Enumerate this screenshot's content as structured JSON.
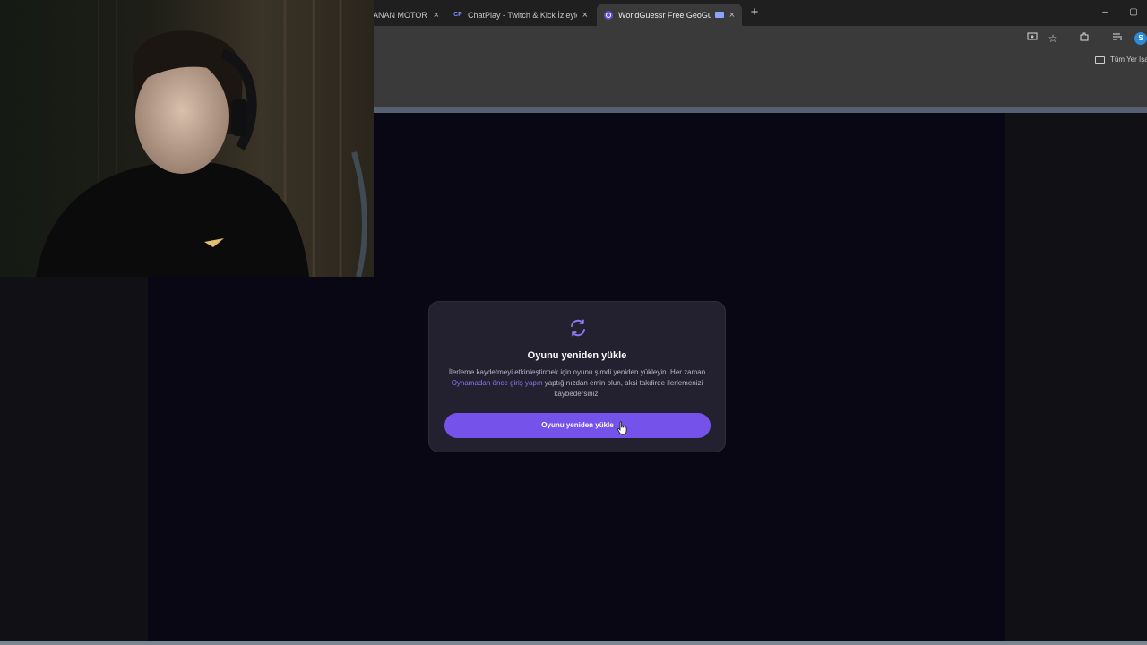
{
  "browser": {
    "tabs": [
      {
        "title": "ANAN MOTOR",
        "favicon": ""
      },
      {
        "title": "ChatPlay - Twitch & Kick İzleyici",
        "favicon": "CP"
      },
      {
        "title": "WorldGuessr Free GeoGuessr",
        "favicon": "worldguessr-logo-icon"
      }
    ],
    "new_tab_label": "+",
    "close_label": "×",
    "minimize_label": "–",
    "maximize_label": "▢",
    "profile_initial": "S",
    "bookmarks_all_label": "Tüm Yer İşa"
  },
  "modal": {
    "icon": "reload-icon",
    "title": "Oyunu yeniden yükle",
    "body_part1": "İlerleme kaydetmeyi etkinleştirmek için oyunu şimdi yeniden yükleyin. Her zaman ",
    "body_link": "Oynamadan önce giriş yapın",
    "body_part2": " yaptığınızdan emin olun, aksi takdirde ilerlemenizi kaybedersiniz.",
    "button_label": "Oyunu yeniden yükle"
  },
  "colors": {
    "accent": "#7552ea",
    "link": "#8c77f0",
    "modal_bg": "#23212f",
    "page_bg": "#080713"
  }
}
